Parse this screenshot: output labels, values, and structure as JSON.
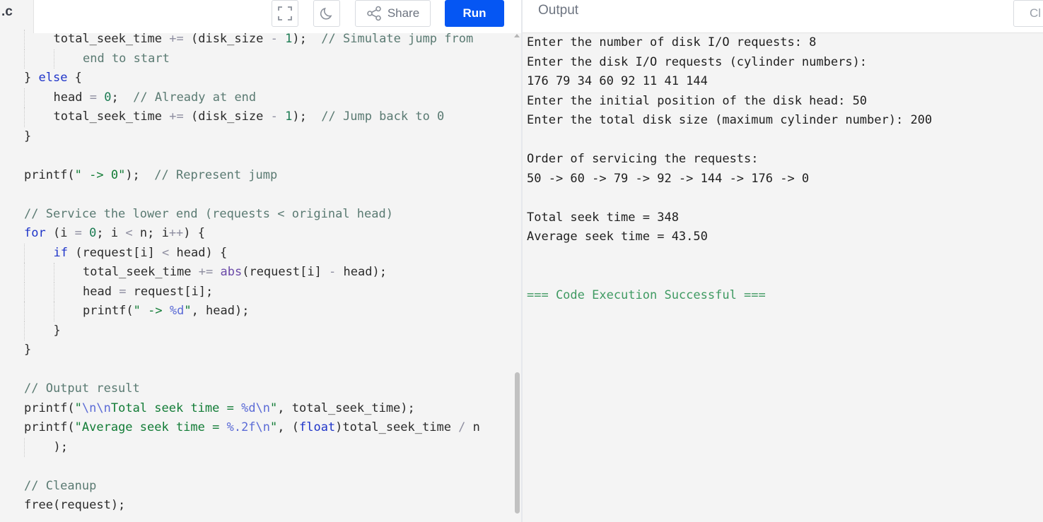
{
  "editor": {
    "file_tab": ".c",
    "toolbar": {
      "fullscreen_icon": "fullscreen-icon",
      "theme_icon": "moon-icon",
      "share_icon": "share-icon",
      "share_label": "Share",
      "run_label": "Run"
    }
  },
  "output": {
    "title": "Output",
    "clear_label": "Cl",
    "lines": [
      "Enter the number of disk I/O requests: 8",
      "Enter the disk I/O requests (cylinder numbers):",
      "176 79 34 60 92 11 41 144",
      "Enter the initial position of the disk head: 50",
      "Enter the total disk size (maximum cylinder number): 200",
      "",
      "Order of servicing the requests:",
      "50 -> 60 -> 79 -> 92 -> 144 -> 176 -> 0",
      "",
      "Total seek time = 348",
      "Average seek time = 43.50",
      "",
      "",
      "=== Code Execution Successful ==="
    ]
  },
  "code": {
    "lines": [
      {
        "indent": 1,
        "tokens": [
          [
            "",
            "total_seek_time "
          ],
          [
            "op",
            "+="
          ],
          [
            "",
            " (disk_size "
          ],
          [
            "op",
            "-"
          ],
          [
            "",
            " "
          ],
          [
            "num",
            "1"
          ],
          [
            "",
            ");  "
          ],
          [
            "cm",
            "// Simulate jump from"
          ]
        ]
      },
      {
        "indent": 2,
        "tokens": [
          [
            "cm",
            "end to start"
          ]
        ]
      },
      {
        "indent": 0,
        "tokens": [
          [
            "",
            "} "
          ],
          [
            "kw",
            "else"
          ],
          [
            "",
            " {"
          ]
        ]
      },
      {
        "indent": 1,
        "tokens": [
          [
            "",
            "head "
          ],
          [
            "op",
            "="
          ],
          [
            "",
            " "
          ],
          [
            "num",
            "0"
          ],
          [
            "",
            ";  "
          ],
          [
            "cm",
            "// Already at end"
          ]
        ]
      },
      {
        "indent": 1,
        "tokens": [
          [
            "",
            "total_seek_time "
          ],
          [
            "op",
            "+="
          ],
          [
            "",
            " (disk_size "
          ],
          [
            "op",
            "-"
          ],
          [
            "",
            " "
          ],
          [
            "num",
            "1"
          ],
          [
            "",
            ");  "
          ],
          [
            "cm",
            "// Jump back to 0"
          ]
        ]
      },
      {
        "indent": 0,
        "tokens": [
          [
            "",
            "}"
          ]
        ]
      },
      {
        "indent": 0,
        "tokens": []
      },
      {
        "indent": 0,
        "tokens": [
          [
            "",
            "printf("
          ],
          [
            "str",
            "\" -> 0\""
          ],
          [
            "",
            ");  "
          ],
          [
            "cm",
            "// Represent jump"
          ]
        ]
      },
      {
        "indent": 0,
        "tokens": []
      },
      {
        "indent": 0,
        "tokens": [
          [
            "cm",
            "// Service the lower end (requests < original head)"
          ]
        ]
      },
      {
        "indent": 0,
        "tokens": [
          [
            "kw",
            "for"
          ],
          [
            "",
            " (i "
          ],
          [
            "op",
            "="
          ],
          [
            "",
            " "
          ],
          [
            "num",
            "0"
          ],
          [
            "",
            "; i "
          ],
          [
            "op",
            "<"
          ],
          [
            "",
            " n; i"
          ],
          [
            "op",
            "++"
          ],
          [
            "",
            ") {"
          ]
        ]
      },
      {
        "indent": 1,
        "tokens": [
          [
            "kw",
            "if"
          ],
          [
            "",
            " (request[i] "
          ],
          [
            "op",
            "<"
          ],
          [
            "",
            " head) {"
          ]
        ]
      },
      {
        "indent": 2,
        "tokens": [
          [
            "",
            "total_seek_time "
          ],
          [
            "op",
            "+="
          ],
          [
            "",
            " "
          ],
          [
            "fn",
            "abs"
          ],
          [
            "",
            "(request[i] "
          ],
          [
            "op",
            "-"
          ],
          [
            "",
            " head);"
          ]
        ]
      },
      {
        "indent": 2,
        "tokens": [
          [
            "",
            "head "
          ],
          [
            "op",
            "="
          ],
          [
            "",
            " request[i];"
          ]
        ]
      },
      {
        "indent": 2,
        "tokens": [
          [
            "",
            "printf("
          ],
          [
            "str",
            "\" -> "
          ],
          [
            "esc",
            "%d"
          ],
          [
            "str",
            "\""
          ],
          [
            "",
            ", head);"
          ]
        ]
      },
      {
        "indent": 1,
        "tokens": [
          [
            "",
            "}"
          ]
        ]
      },
      {
        "indent": 0,
        "tokens": [
          [
            "",
            "}"
          ]
        ]
      },
      {
        "indent": 0,
        "tokens": []
      },
      {
        "indent": 0,
        "tokens": [
          [
            "cm",
            "// Output result"
          ]
        ]
      },
      {
        "indent": 0,
        "tokens": [
          [
            "",
            "printf("
          ],
          [
            "str",
            "\""
          ],
          [
            "esc",
            "\\n\\n"
          ],
          [
            "str",
            "Total seek time = "
          ],
          [
            "esc",
            "%d\\n"
          ],
          [
            "str",
            "\""
          ],
          [
            "",
            ", total_seek_time);"
          ]
        ]
      },
      {
        "indent": 0,
        "tokens": [
          [
            "",
            "printf("
          ],
          [
            "str",
            "\"Average seek time = "
          ],
          [
            "esc",
            "%.2f\\n"
          ],
          [
            "str",
            "\""
          ],
          [
            "",
            ", ("
          ],
          [
            "kw",
            "float"
          ],
          [
            "",
            ")total_seek_time "
          ],
          [
            "op",
            "/"
          ],
          [
            "",
            " n"
          ]
        ]
      },
      {
        "indent": 1,
        "tokens": [
          [
            "",
            ");"
          ]
        ]
      },
      {
        "indent": 0,
        "tokens": []
      },
      {
        "indent": 0,
        "tokens": [
          [
            "cm",
            "// Cleanup"
          ]
        ]
      },
      {
        "indent": 0,
        "tokens": [
          [
            "",
            "free(request);"
          ]
        ]
      }
    ]
  }
}
